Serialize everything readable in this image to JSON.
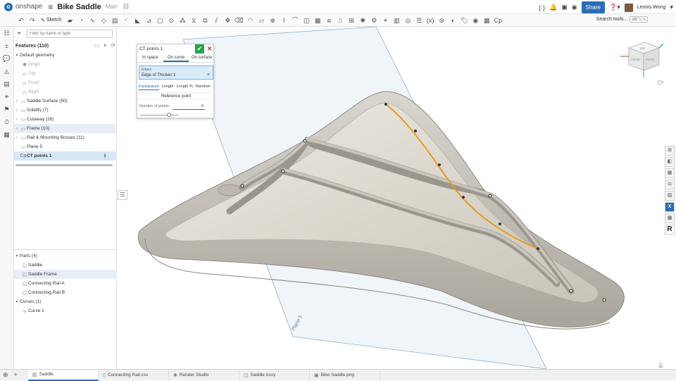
{
  "app": {
    "logo": "onshape",
    "doc_title": "Bike Saddle",
    "branch": "Main"
  },
  "topbar": {
    "share": "Share",
    "user": "Leonis Wong"
  },
  "toolbar": {
    "sketch": "Sketch",
    "search_tools": "Search tools...",
    "shortcut": "alt/⌥ c"
  },
  "feature_panel": {
    "filter_placeholder": "Filter by name or type",
    "title": "Features (110)",
    "items": [
      {
        "label": "Default geometry"
      },
      {
        "label": "Origin"
      },
      {
        "label": "Top"
      },
      {
        "label": "Front"
      },
      {
        "label": "Right"
      },
      {
        "label": "Saddle Surface (50)"
      },
      {
        "label": "Solidify (7)"
      },
      {
        "label": "Cutaway (26)"
      },
      {
        "label": "Frame (10)"
      },
      {
        "label": "Rail & Mounting Bosses (11)"
      },
      {
        "label": "Plane 5"
      },
      {
        "label": "CT points 1"
      }
    ]
  },
  "parts_panel": {
    "parts_header": "Parts (4)",
    "parts": [
      "Saddle",
      "Saddle Frame",
      "Connecting Rail A",
      "Connecting Rail B"
    ],
    "curves_header": "Curves (1)",
    "curves": [
      "Curve 1"
    ]
  },
  "dialog": {
    "title": "CT points 1",
    "tabs": [
      "In space",
      "On curve",
      "On surface"
    ],
    "active_tab": "On curve",
    "edges_label": "Edges",
    "edges_value": "Edge of Thicken 1",
    "modes": [
      "Equispaced",
      "Length",
      "Length %",
      "Random"
    ],
    "reference_point": "Reference point",
    "num_points_label": "Number of points",
    "num_points": "8",
    "slider_fraction": 0.75
  },
  "viewport": {
    "plane_label": "Plane 5",
    "cube_faces": [
      "TOP",
      "FRONT",
      "RIGHT"
    ]
  },
  "colors": {
    "accent": "#2a6db5",
    "selection": "#e89a20",
    "model": "#cbc7bd"
  },
  "tabs": [
    {
      "label": "Saddle",
      "icon": "part-studio-icon"
    },
    {
      "label": "Connecting Rail.csv",
      "icon": "file-icon"
    },
    {
      "label": "Render Studio",
      "icon": "render-icon"
    },
    {
      "label": "Saddle Assy",
      "icon": "assembly-icon"
    },
    {
      "label": "Bike Saddle.png",
      "icon": "image-icon"
    }
  ]
}
